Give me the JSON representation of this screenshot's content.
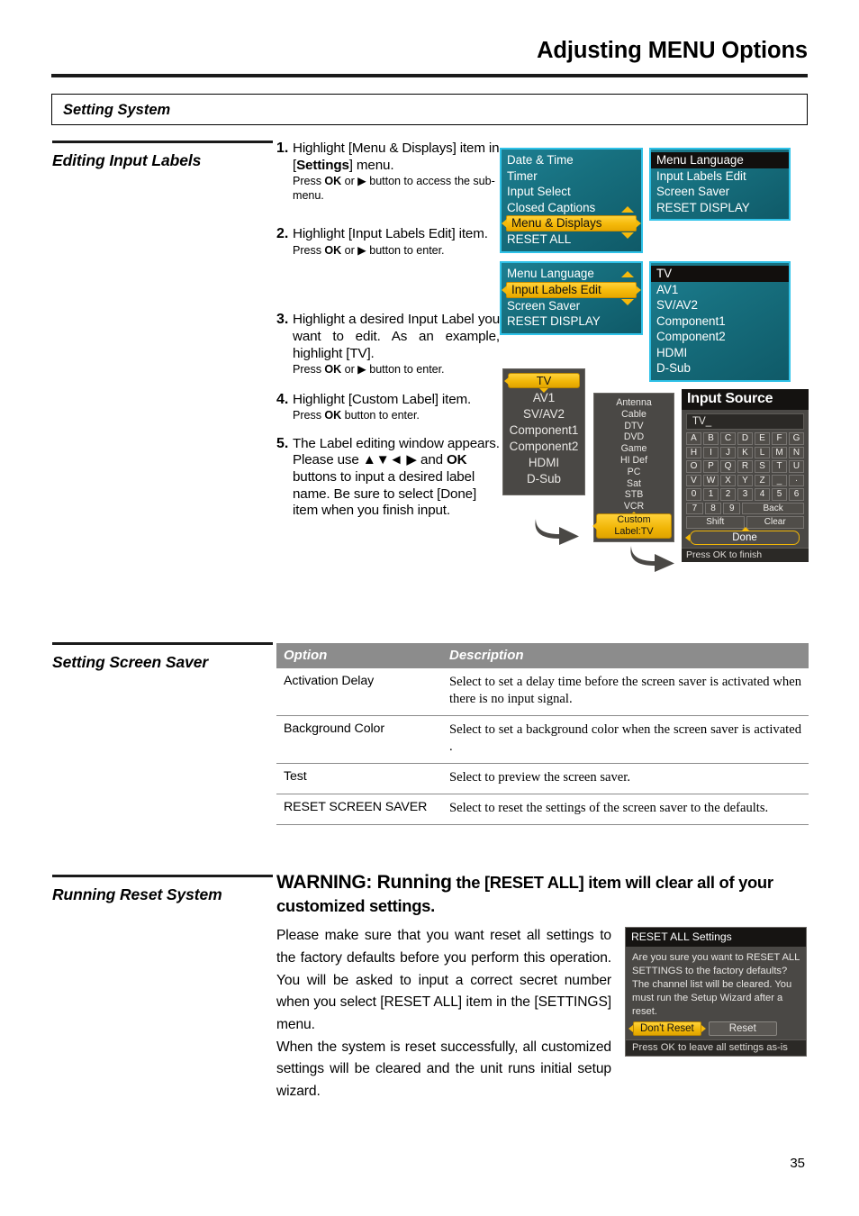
{
  "header": {
    "title": "Adjusting MENU Options",
    "section_box": "Setting System"
  },
  "sections": {
    "editing_input_labels": "Editing Input Labels",
    "setting_screen_saver": "Setting Screen Saver",
    "running_reset_system": "Running Reset System"
  },
  "steps": [
    {
      "num": "1.",
      "main_a": "Highlight [Menu & Displays] item in [",
      "main_bold": "Settings",
      "main_b": "] menu.",
      "sub_a": "Press ",
      "sub_bold": "OK",
      "sub_b": " or ▶ button to access the sub-menu."
    },
    {
      "num": "2.",
      "main_a": "Highlight [Input Labels Edit] item.",
      "sub_a": "Press ",
      "sub_bold": "OK",
      "sub_b": " or ▶ button to enter."
    },
    {
      "num": "3.",
      "main_a": "Highlight a desired Input Label you want to edit. As an example, highlight [TV].",
      "sub_a": "Press ",
      "sub_bold": "OK",
      "sub_b": " or ▶ button to enter."
    },
    {
      "num": "4.",
      "main_a": "Highlight [Custom Label] item.",
      "sub_a": "Press ",
      "sub_bold": "OK",
      "sub_b": " button to enter."
    },
    {
      "num": "5.",
      "main_a": "The Label editing window appears. Please use ▲▼◄ ▶ and ",
      "main_bold": "OK",
      "main_b": " buttons to input a desired label name. Be sure to select [Done] item when you finish input."
    }
  ],
  "osd": {
    "settings_menu": {
      "items": [
        "Date & Time",
        "Timer",
        "Input Select",
        "Closed Captions",
        "Menu & Displays",
        "RESET ALL"
      ],
      "highlighted": "Menu & Displays"
    },
    "menu_displays_submenu": {
      "items": [
        "Menu Language",
        "Input Labels Edit",
        "Screen Saver",
        "RESET DISPLAY"
      ],
      "selected": "Menu Language"
    },
    "menu_displays_menu2": {
      "items": [
        "Menu Language",
        "Input Labels Edit",
        "Screen Saver",
        "RESET DISPLAY"
      ],
      "highlighted": "Input Labels Edit"
    },
    "input_list_teal": {
      "items": [
        "TV",
        "AV1",
        "SV/AV2",
        "Component1",
        "Component2",
        "HDMI",
        "D-Sub"
      ],
      "selected": "TV"
    },
    "input_list_gray": {
      "items": [
        "TV",
        "AV1",
        "SV/AV2",
        "Component1",
        "Component2",
        "HDMI",
        "D-Sub"
      ],
      "highlighted": "TV"
    },
    "label_list": {
      "items": [
        "Antenna",
        "Cable",
        "DTV",
        "DVD",
        "Game",
        "HI Def",
        "PC",
        "Sat",
        "STB",
        "VCR"
      ],
      "custom_label": "Custom Label:TV"
    },
    "keyboard": {
      "title": "Input Source",
      "field_value": "TV_",
      "rows": [
        [
          "A",
          "B",
          "C",
          "D",
          "E",
          "F",
          "G"
        ],
        [
          "H",
          "I",
          "J",
          "K",
          "L",
          "M",
          "N"
        ],
        [
          "O",
          "P",
          "Q",
          "R",
          "S",
          "T",
          "U"
        ],
        [
          "V",
          "W",
          "X",
          "Y",
          "Z",
          "_",
          "·"
        ],
        [
          "0",
          "1",
          "2",
          "3",
          "4",
          "5",
          "6"
        ]
      ],
      "row6": [
        "7",
        "8",
        "9"
      ],
      "back_label": "Back",
      "shift_label": "Shift",
      "clear_label": "Clear",
      "done_label": "Done",
      "footer": "Press OK to finish"
    }
  },
  "screen_saver_table": {
    "headers": [
      "Option",
      "Description"
    ],
    "rows": [
      {
        "option": "Activation Delay",
        "description": "Select to set a delay time before the screen saver is activated when there is no input signal."
      },
      {
        "option": "Background Color",
        "description": "Select to set a background color when the screen saver is activated ."
      },
      {
        "option": "Test",
        "description": "Select to preview the screen saver."
      },
      {
        "option": "RESET SCREEN SAVER",
        "description": "Select to reset the settings of the screen saver to the defaults."
      }
    ]
  },
  "warning": {
    "title_strong": "WARNING: Running",
    "title_rest": " the [RESET ALL] item will clear all of your customized settings.",
    "body": "Please make sure that you want reset all settings to the factory defaults before you perform this operation. You will be asked to input a correct secret number when you select [RESET ALL] item in the [SETTINGS] menu.\nWhen the system is reset successfully, all customized settings will be cleared and the unit runs initial setup wizard.",
    "body_p1": "Please make sure that you want reset all settings to the factory defaults before you perform this operation. You will be asked to input a correct secret number when you select [RESET ALL] item in the [SETTINGS] menu.",
    "body_p2": "When the system is reset successfully, all customized settings will be cleared and the unit runs initial setup wizard."
  },
  "reset_dialog": {
    "title": "RESET ALL Settings",
    "message": "Are you sure you want to RESET ALL SETTINGS to the factory defaults? The channel list will be cleared. You must run the Setup Wizard after a reset.",
    "dont_reset": "Don't Reset",
    "reset": "Reset",
    "footer": "Press OK to leave all settings as-is"
  },
  "page_number": "35",
  "colors": {
    "teal_menu": "#17707f",
    "teal_border": "#2fc2e8",
    "highlight_yellow": "#f0b506",
    "gray_panel": "#4a4845",
    "table_header": "#8c8c8c"
  }
}
